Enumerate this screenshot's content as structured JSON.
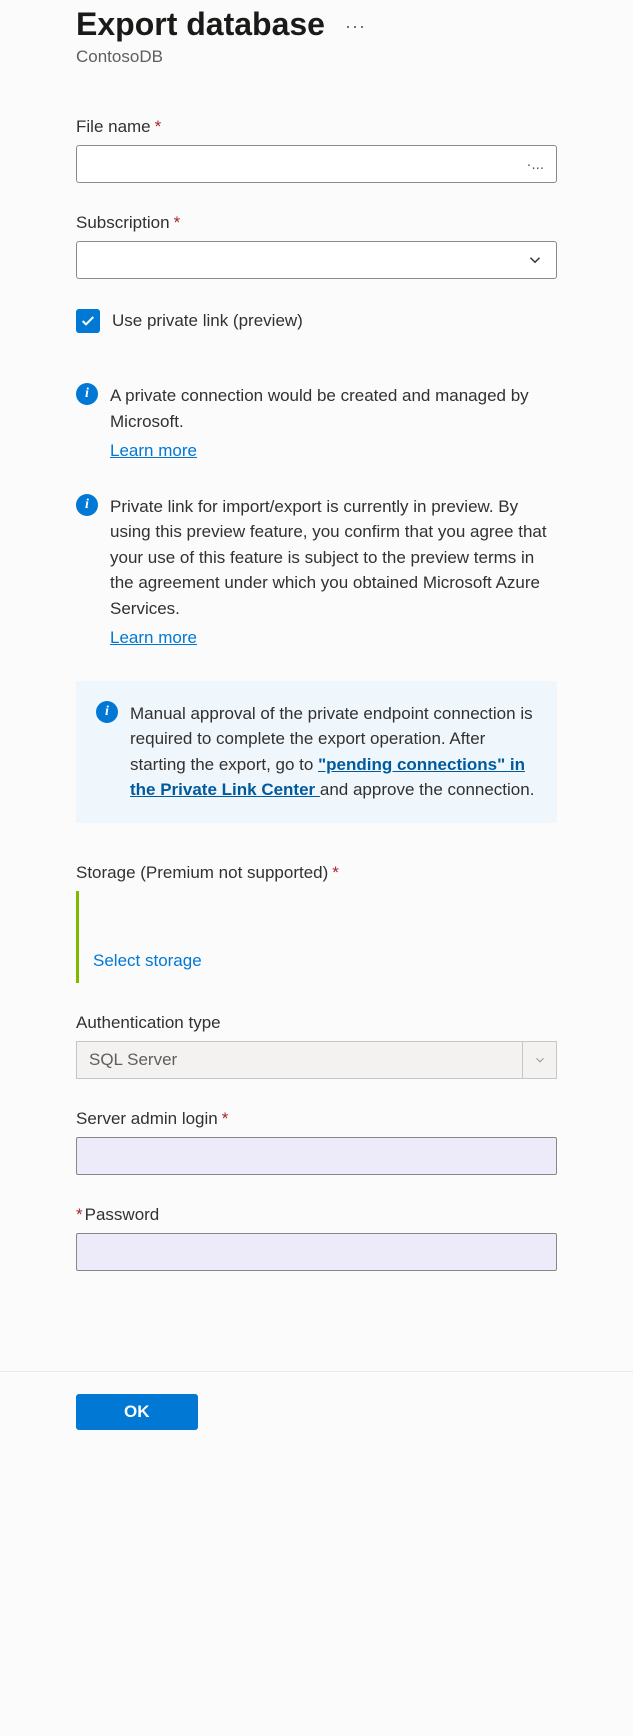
{
  "header": {
    "title": "Export database",
    "subtitle": "ContosoDB"
  },
  "fileName": {
    "label": "File name",
    "value": "·..."
  },
  "subscription": {
    "label": "Subscription",
    "value": ""
  },
  "privateLink": {
    "label": "Use private link (preview)",
    "checked": true
  },
  "info1": {
    "text": "A private connection would be created and managed by Microsoft.",
    "link": "Learn more"
  },
  "info2": {
    "text": "Private link for import/export is currently in preview. By using this preview feature, you confirm that you agree that your use of this feature is subject to the preview terms in the agreement under which you obtained Microsoft Azure Services.",
    "link": "Learn more"
  },
  "callout": {
    "textBefore": "Manual approval of the private endpoint connection is required to complete the export operation. After starting the export, go to ",
    "linkText": "\"pending connections\" in the Private Link Center ",
    "textAfter": "and approve the connection."
  },
  "storage": {
    "label": "Storage (Premium not supported)",
    "link": "Select storage"
  },
  "authType": {
    "label": "Authentication type",
    "value": "SQL Server"
  },
  "adminLogin": {
    "label": "Server admin login"
  },
  "password": {
    "label": "Password"
  },
  "footer": {
    "okLabel": "OK"
  }
}
